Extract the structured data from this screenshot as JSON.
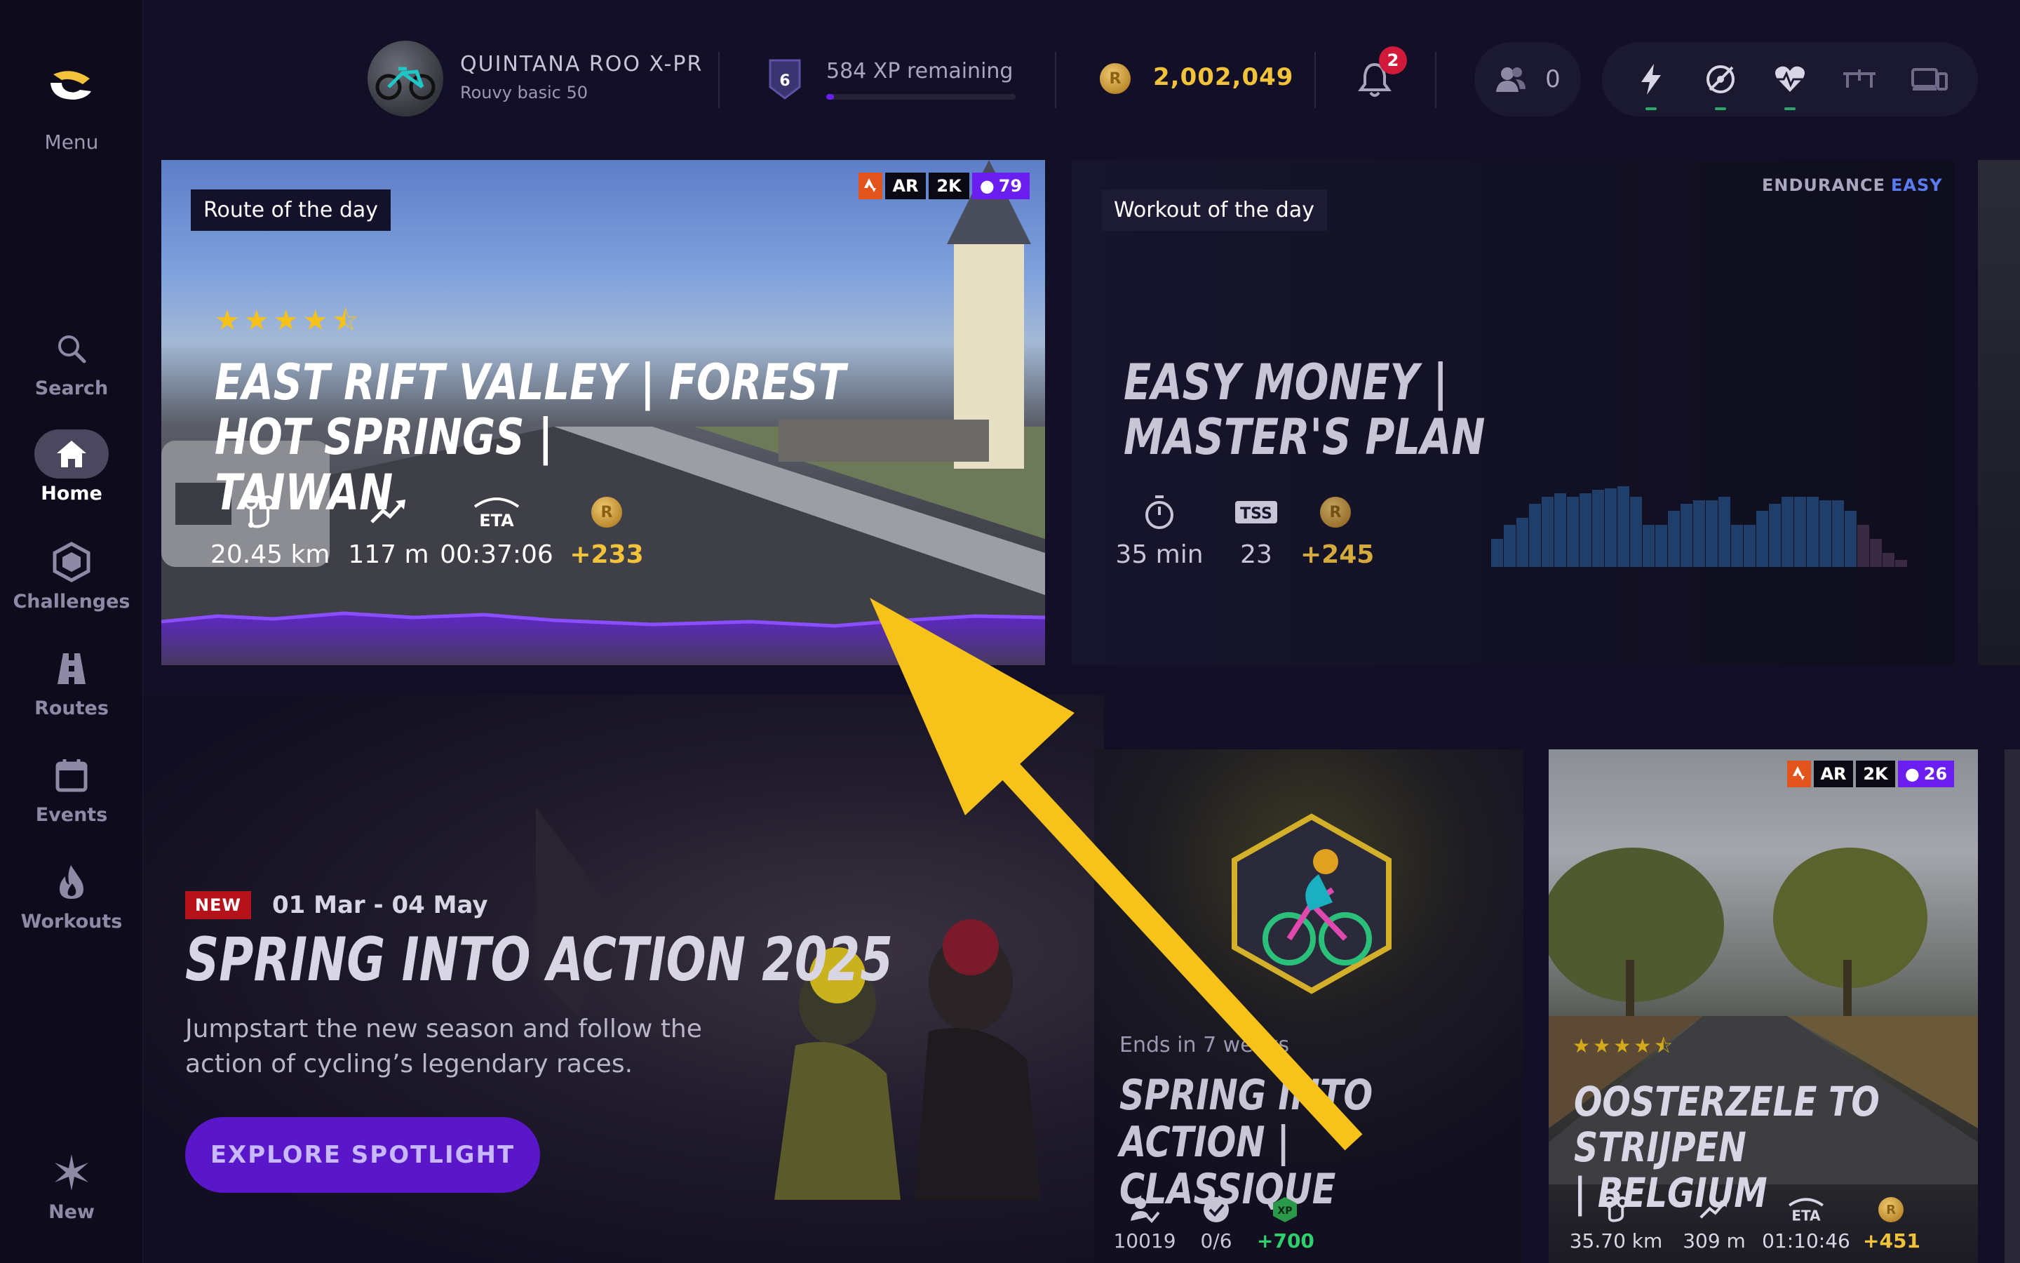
{
  "sidebar": {
    "menu_label": "Menu",
    "items": [
      {
        "label": "Search",
        "icon": "search-icon"
      },
      {
        "label": "Home",
        "icon": "home-icon"
      },
      {
        "label": "Challenges",
        "icon": "hexagon-icon"
      },
      {
        "label": "Routes",
        "icon": "road-icon"
      },
      {
        "label": "Events",
        "icon": "calendar-icon"
      },
      {
        "label": "Workouts",
        "icon": "flame-icon"
      },
      {
        "label": "New",
        "icon": "sparkle-icon"
      }
    ],
    "active": "Home"
  },
  "topbar": {
    "bike_name": "QUINTANA ROO X-PR",
    "bike_sub": "Rouvy basic 50",
    "level": "6",
    "xp_text": "584 XP remaining",
    "xp_progress": 0.04,
    "coins": "2,002,049",
    "coin_glyph": "R",
    "notifications": "2",
    "friends": "0",
    "sensors": [
      {
        "icon": "power-icon",
        "connected": true
      },
      {
        "icon": "cadence-icon",
        "connected": true
      },
      {
        "icon": "heart-rate-icon",
        "connected": true
      },
      {
        "icon": "trainer-icon",
        "connected": false
      },
      {
        "icon": "devices-icon",
        "connected": false
      }
    ]
  },
  "route_of_day": {
    "tag": "Route of the day",
    "chips": {
      "ar": "AR",
      "k2": "2K",
      "count": "79"
    },
    "rating": 4.5,
    "title_line1": "EAST RIFT VALLEY | FOREST HOT SPRINGS |",
    "title_line2": "TAIWAN",
    "stats": [
      {
        "icon": "distance-icon",
        "value": "20.45 km"
      },
      {
        "icon": "elevation-icon",
        "value": "117 m"
      },
      {
        "icon": "eta-icon",
        "icon_text": "ETA",
        "value": "00:37:06"
      },
      {
        "icon": "coin-icon",
        "value": "+233"
      }
    ]
  },
  "workout_of_day": {
    "tag": "Workout of the day",
    "category": "ENDURANCE",
    "difficulty": "EASY",
    "title_line1": "EASY MONEY |",
    "title_line2": "MASTER'S PLAN",
    "stats": [
      {
        "icon": "timer-icon",
        "value": "35 min"
      },
      {
        "icon": "tss-icon",
        "icon_text": "TSS",
        "value": "23"
      },
      {
        "icon": "coin-icon",
        "value": "+245"
      }
    ]
  },
  "spotlight": {
    "badge": "NEW",
    "dates": "01 Mar - 04 May",
    "title": "SPRING INTO ACTION 2025",
    "desc_line1": "Jumpstart the new season and follow the",
    "desc_line2": "action of cycling’s legendary races.",
    "button": "EXPLORE SPOTLIGHT"
  },
  "challenge_card": {
    "ends": "Ends in 7 weeks",
    "title_line1": "SPRING INTO ACTION |",
    "title_line2": "CLASSIQUE",
    "stats": [
      {
        "icon": "participants-icon",
        "value": "10019"
      },
      {
        "icon": "check-icon",
        "value": "0/6"
      },
      {
        "icon": "xp-icon",
        "icon_text": "XP",
        "value": "+700"
      }
    ]
  },
  "route_card_2": {
    "chips": {
      "ar": "AR",
      "k2": "2K",
      "count": "26"
    },
    "rating": 4.5,
    "title_line1": "OOSTERZELE TO STRIJPEN",
    "title_line2": "| BELGIUM",
    "stats": [
      {
        "icon": "distance-icon",
        "value": "35.70 km"
      },
      {
        "icon": "elevation-icon",
        "value": "309 m"
      },
      {
        "icon": "eta-icon",
        "icon_text": "ETA",
        "value": "01:10:46"
      },
      {
        "icon": "coin-icon",
        "value": "+451"
      }
    ]
  },
  "colors": {
    "accent": "#6a1ef0",
    "gold": "#f2c23a",
    "annotation_arrow": "#f7c21a"
  }
}
